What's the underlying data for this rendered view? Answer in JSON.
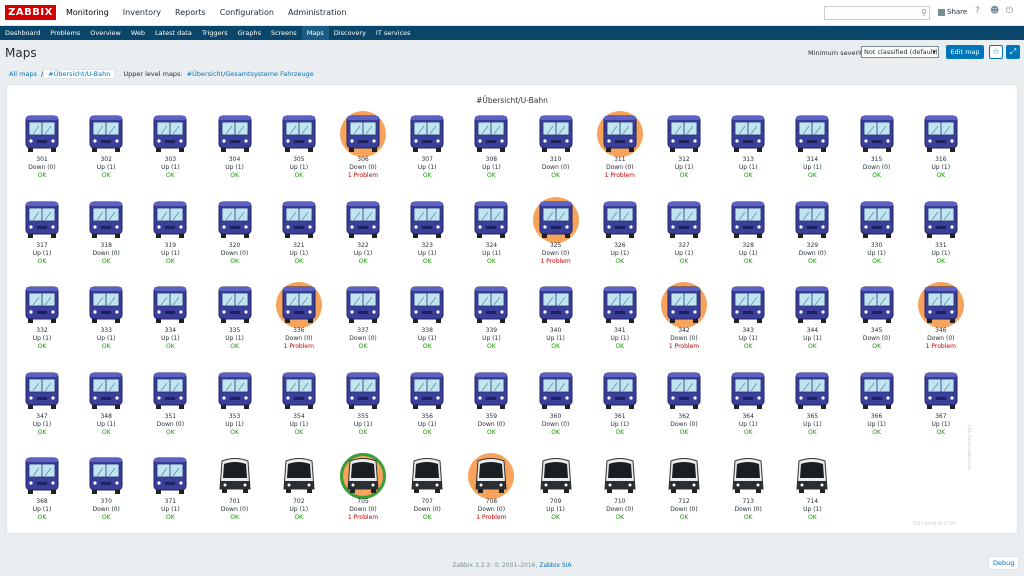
{
  "header": {
    "logo": "ZABBIX",
    "menu": [
      "Monitoring",
      "Inventory",
      "Reports",
      "Configuration",
      "Administration"
    ],
    "share_label": "Share",
    "help_icon": "?",
    "user_icon": "user-icon",
    "logout_icon": "power-icon"
  },
  "submenu": [
    "Dashboard",
    "Problems",
    "Overview",
    "Web",
    "Latest data",
    "Triggers",
    "Graphs",
    "Screens",
    "Maps",
    "Discovery",
    "IT services"
  ],
  "page": {
    "title": "Maps",
    "min_severity_label": "Minimum severity",
    "min_severity_value": "Not classified (default)",
    "edit_map_label": "Edit map"
  },
  "breadcrumbs": {
    "all_maps": "All maps",
    "sep": "/",
    "current": "#Übersicht/U-Bahn",
    "upper_label": "Upper level maps:",
    "upper_link": "#Übersicht/Gesamtsysteme Fahrzeuge"
  },
  "map": {
    "title": "#Übersicht/U-Bahn",
    "watermark": "2017-09-06 09:07:20",
    "vertical_watermark": "http://www.zabbix.com",
    "nodes": [
      {
        "name": "301",
        "status": "Down (0)",
        "state": "OK",
        "type": "blue"
      },
      {
        "name": "302",
        "status": "Up (1)",
        "state": "OK",
        "type": "blue"
      },
      {
        "name": "303",
        "status": "Up (1)",
        "state": "OK",
        "type": "blue"
      },
      {
        "name": "304",
        "status": "Up (1)",
        "state": "OK",
        "type": "blue"
      },
      {
        "name": "305",
        "status": "Up (1)",
        "state": "OK",
        "type": "blue"
      },
      {
        "name": "306",
        "status": "Down (0)",
        "state": "1 Problem",
        "type": "blue",
        "halo": "orange"
      },
      {
        "name": "307",
        "status": "Up (1)",
        "state": "OK",
        "type": "blue"
      },
      {
        "name": "308",
        "status": "Up (1)",
        "state": "OK",
        "type": "blue"
      },
      {
        "name": "310",
        "status": "Down (0)",
        "state": "OK",
        "type": "blue"
      },
      {
        "name": "311",
        "status": "Down (0)",
        "state": "1 Problem",
        "type": "blue",
        "halo": "orange"
      },
      {
        "name": "312",
        "status": "Up (1)",
        "state": "OK",
        "type": "blue"
      },
      {
        "name": "313",
        "status": "Up (1)",
        "state": "OK",
        "type": "blue"
      },
      {
        "name": "314",
        "status": "Up (1)",
        "state": "OK",
        "type": "blue"
      },
      {
        "name": "315",
        "status": "Down (0)",
        "state": "OK",
        "type": "blue"
      },
      {
        "name": "316",
        "status": "Up (1)",
        "state": "OK",
        "type": "blue"
      },
      {
        "name": "317",
        "status": "Up (1)",
        "state": "OK",
        "type": "blue"
      },
      {
        "name": "318",
        "status": "Down (0)",
        "state": "OK",
        "type": "blue"
      },
      {
        "name": "319",
        "status": "Up (1)",
        "state": "OK",
        "type": "blue"
      },
      {
        "name": "320",
        "status": "Down (0)",
        "state": "OK",
        "type": "blue"
      },
      {
        "name": "321",
        "status": "Up (1)",
        "state": "OK",
        "type": "blue"
      },
      {
        "name": "322",
        "status": "Up (1)",
        "state": "OK",
        "type": "blue"
      },
      {
        "name": "323",
        "status": "Up (1)",
        "state": "OK",
        "type": "blue"
      },
      {
        "name": "324",
        "status": "Up (1)",
        "state": "OK",
        "type": "blue"
      },
      {
        "name": "325",
        "status": "Down (0)",
        "state": "1 Problem",
        "type": "blue",
        "halo": "orange"
      },
      {
        "name": "326",
        "status": "Up (1)",
        "state": "OK",
        "type": "blue"
      },
      {
        "name": "327",
        "status": "Up (1)",
        "state": "OK",
        "type": "blue"
      },
      {
        "name": "328",
        "status": "Up (1)",
        "state": "OK",
        "type": "blue"
      },
      {
        "name": "329",
        "status": "Down (0)",
        "state": "OK",
        "type": "blue"
      },
      {
        "name": "330",
        "status": "Up (1)",
        "state": "OK",
        "type": "blue"
      },
      {
        "name": "331",
        "status": "Up (1)",
        "state": "OK",
        "type": "blue"
      },
      {
        "name": "332",
        "status": "Up (1)",
        "state": "OK",
        "type": "blue"
      },
      {
        "name": "333",
        "status": "Up (1)",
        "state": "OK",
        "type": "blue"
      },
      {
        "name": "334",
        "status": "Up (1)",
        "state": "OK",
        "type": "blue"
      },
      {
        "name": "335",
        "status": "Up (1)",
        "state": "OK",
        "type": "blue"
      },
      {
        "name": "336",
        "status": "Down (0)",
        "state": "1 Problem",
        "type": "blue",
        "halo": "orange"
      },
      {
        "name": "337",
        "status": "Down (0)",
        "state": "OK",
        "type": "blue"
      },
      {
        "name": "338",
        "status": "Up (1)",
        "state": "OK",
        "type": "blue"
      },
      {
        "name": "339",
        "status": "Up (1)",
        "state": "OK",
        "type": "blue"
      },
      {
        "name": "340",
        "status": "Up (1)",
        "state": "OK",
        "type": "blue"
      },
      {
        "name": "341",
        "status": "Up (1)",
        "state": "OK",
        "type": "blue"
      },
      {
        "name": "342",
        "status": "Down (0)",
        "state": "1 Problem",
        "type": "blue",
        "halo": "orange"
      },
      {
        "name": "343",
        "status": "Up (1)",
        "state": "OK",
        "type": "blue"
      },
      {
        "name": "344",
        "status": "Up (1)",
        "state": "OK",
        "type": "blue"
      },
      {
        "name": "345",
        "status": "Down (0)",
        "state": "OK",
        "type": "blue"
      },
      {
        "name": "346",
        "status": "Down (0)",
        "state": "1 Problem",
        "type": "blue",
        "halo": "orange"
      },
      {
        "name": "347",
        "status": "Up (1)",
        "state": "OK",
        "type": "blue"
      },
      {
        "name": "348",
        "status": "Up (1)",
        "state": "OK",
        "type": "blue"
      },
      {
        "name": "351",
        "status": "Down (0)",
        "state": "OK",
        "type": "blue"
      },
      {
        "name": "353",
        "status": "Up (1)",
        "state": "OK",
        "type": "blue"
      },
      {
        "name": "354",
        "status": "Up (1)",
        "state": "OK",
        "type": "blue"
      },
      {
        "name": "355",
        "status": "Up (1)",
        "state": "OK",
        "type": "blue"
      },
      {
        "name": "356",
        "status": "Up (1)",
        "state": "OK",
        "type": "blue"
      },
      {
        "name": "359",
        "status": "Down (0)",
        "state": "OK",
        "type": "blue"
      },
      {
        "name": "360",
        "status": "Down (0)",
        "state": "OK",
        "type": "blue"
      },
      {
        "name": "361",
        "status": "Up (1)",
        "state": "OK",
        "type": "blue"
      },
      {
        "name": "362",
        "status": "Down (0)",
        "state": "OK",
        "type": "blue"
      },
      {
        "name": "364",
        "status": "Up (1)",
        "state": "OK",
        "type": "blue"
      },
      {
        "name": "365",
        "status": "Up (1)",
        "state": "OK",
        "type": "blue"
      },
      {
        "name": "366",
        "status": "Up (1)",
        "state": "OK",
        "type": "blue"
      },
      {
        "name": "367",
        "status": "Up (1)",
        "state": "OK",
        "type": "blue"
      },
      {
        "name": "368",
        "status": "Up (1)",
        "state": "OK",
        "type": "blue"
      },
      {
        "name": "370",
        "status": "Down (0)",
        "state": "OK",
        "type": "blue"
      },
      {
        "name": "371",
        "status": "Up (1)",
        "state": "OK",
        "type": "blue"
      },
      {
        "name": "701",
        "status": "Down (0)",
        "state": "OK",
        "type": "dark"
      },
      {
        "name": "702",
        "status": "Up (1)",
        "state": "OK",
        "type": "dark"
      },
      {
        "name": "705",
        "status": "Down (0)",
        "state": "1 Problem",
        "type": "dark",
        "halo": "green"
      },
      {
        "name": "707",
        "status": "Down (0)",
        "state": "OK",
        "type": "dark"
      },
      {
        "name": "708",
        "status": "Down (0)",
        "state": "1 Problem",
        "type": "dark",
        "halo": "orange"
      },
      {
        "name": "709",
        "status": "Up (1)",
        "state": "OK",
        "type": "dark"
      },
      {
        "name": "710",
        "status": "Down (0)",
        "state": "OK",
        "type": "dark"
      },
      {
        "name": "712",
        "status": "Down (0)",
        "state": "OK",
        "type": "dark"
      },
      {
        "name": "713",
        "status": "Down (0)",
        "state": "OK",
        "type": "dark"
      },
      {
        "name": "714",
        "status": "Up (1)",
        "state": "OK",
        "type": "dark"
      }
    ]
  },
  "footer": {
    "text": "Zabbix 3.2.3. © 2001–2016,",
    "link": "Zabbix SIA",
    "debug": "Debug"
  },
  "colors": {
    "brand": "#d40000",
    "submenu_bg": "#0a466a",
    "accent": "#0275b8",
    "ok": "#159a00",
    "problem": "#c00000",
    "halo_orange": "#f7a35c",
    "halo_green": "#3a9d36"
  }
}
